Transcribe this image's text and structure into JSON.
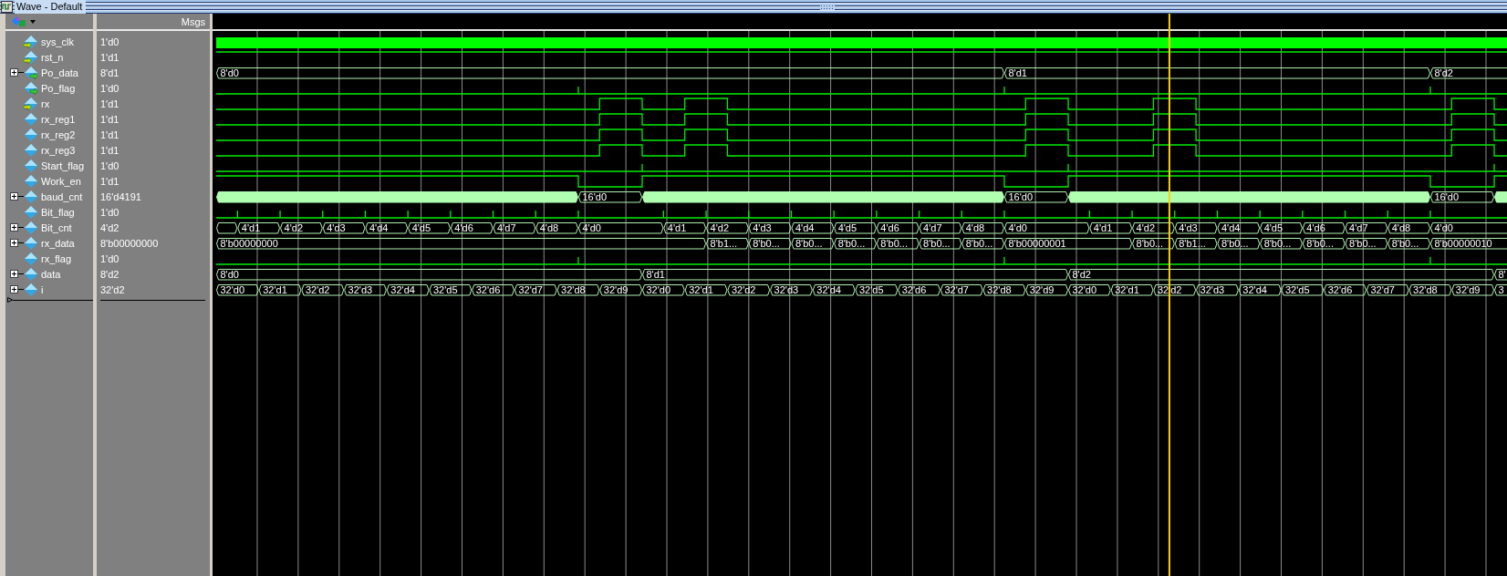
{
  "window": {
    "title": "Wave - Default"
  },
  "values_header": "Msgs",
  "signals": [
    {
      "name": "sys_clk",
      "value": "1'd0",
      "input": true,
      "output": false,
      "expandable": false,
      "kind": "clock"
    },
    {
      "name": "rst_n",
      "value": "1'd1",
      "input": true,
      "output": false,
      "expandable": false,
      "kind": "bit"
    },
    {
      "name": "Po_data",
      "value": "8'd1",
      "input": false,
      "output": true,
      "expandable": true,
      "kind": "bus",
      "labels": [
        "8'd0",
        "8'd1",
        "8'd2"
      ]
    },
    {
      "name": "Po_flag",
      "value": "1'd0",
      "input": false,
      "output": true,
      "expandable": false,
      "kind": "bit"
    },
    {
      "name": "rx",
      "value": "1'd1",
      "input": true,
      "output": false,
      "expandable": false,
      "kind": "bit"
    },
    {
      "name": "rx_reg1",
      "value": "1'd1",
      "input": false,
      "output": false,
      "expandable": false,
      "kind": "bit"
    },
    {
      "name": "rx_reg2",
      "value": "1'd1",
      "input": false,
      "output": false,
      "expandable": false,
      "kind": "bit"
    },
    {
      "name": "rx_reg3",
      "value": "1'd1",
      "input": false,
      "output": false,
      "expandable": false,
      "kind": "bit"
    },
    {
      "name": "Start_flag",
      "value": "1'd0",
      "input": false,
      "output": false,
      "expandable": false,
      "kind": "bit"
    },
    {
      "name": "Work_en",
      "value": "1'd1",
      "input": false,
      "output": false,
      "expandable": false,
      "kind": "bit"
    },
    {
      "name": "baud_cnt",
      "value": "16'd4191",
      "input": false,
      "output": false,
      "expandable": true,
      "kind": "bus",
      "labels": [
        "16'd0",
        "16'd0",
        "16'd0"
      ]
    },
    {
      "name": "Bit_flag",
      "value": "1'd0",
      "input": false,
      "output": false,
      "expandable": false,
      "kind": "bit"
    },
    {
      "name": "Bit_cnt",
      "value": "4'd2",
      "input": false,
      "output": false,
      "expandable": true,
      "kind": "bus",
      "labels": [
        "4'd1",
        "4'd2",
        "4'd3",
        "4'd4",
        "4'd5",
        "4'd6",
        "4'd7",
        "4'd8",
        "4'd0",
        "4'd1",
        "4'd2",
        "4'd3",
        "4'd4",
        "4'd5",
        "4'd6",
        "4'd7",
        "4'd8",
        "4'd0",
        "4'd1",
        "4'd2",
        "4'd3",
        "4'd4",
        "4'd5",
        "4'd6",
        "4'd7",
        "4'd8",
        "4'd0"
      ]
    },
    {
      "name": "rx_data",
      "value": "8'b00000000",
      "input": false,
      "output": false,
      "expandable": true,
      "kind": "bus",
      "labels": [
        "8'b00000000",
        "8'b1...",
        "8'b0...",
        "8'b0...",
        "8'b0...",
        "8'b0...",
        "8'b0...",
        "8'b0...",
        "8'b00000001",
        "8'b0...",
        "8'b1...",
        "8'b0...",
        "8'b0...",
        "8'b0...",
        "8'b0...",
        "8'b0...",
        "8'b00000010"
      ]
    },
    {
      "name": "rx_flag",
      "value": "1'd0",
      "input": false,
      "output": false,
      "expandable": false,
      "kind": "bit"
    },
    {
      "name": "data",
      "value": "8'd2",
      "input": false,
      "output": false,
      "expandable": true,
      "kind": "bus",
      "labels": [
        "8'd0",
        "8'd1",
        "8'd2",
        "8'"
      ]
    },
    {
      "name": "i",
      "value": "32'd2",
      "input": false,
      "output": false,
      "expandable": true,
      "kind": "bus",
      "labels": [
        "32'd0",
        "32'd1",
        "32'd2",
        "32'd3",
        "32'd4",
        "32'd5",
        "32'd6",
        "32'd7",
        "32'd8",
        "32'd9",
        "32'd0",
        "32'd1",
        "32'd2",
        "32'd3",
        "32'd4",
        "32'd5",
        "32'd6",
        "32'd7",
        "32'd8",
        "32'd9",
        "32'd0",
        "32'd1",
        "32'd2",
        "32'd3",
        "32'd4",
        "32'd5",
        "32'd6",
        "32'd7",
        "32'd8",
        "32'd9",
        "3"
      ]
    }
  ]
}
